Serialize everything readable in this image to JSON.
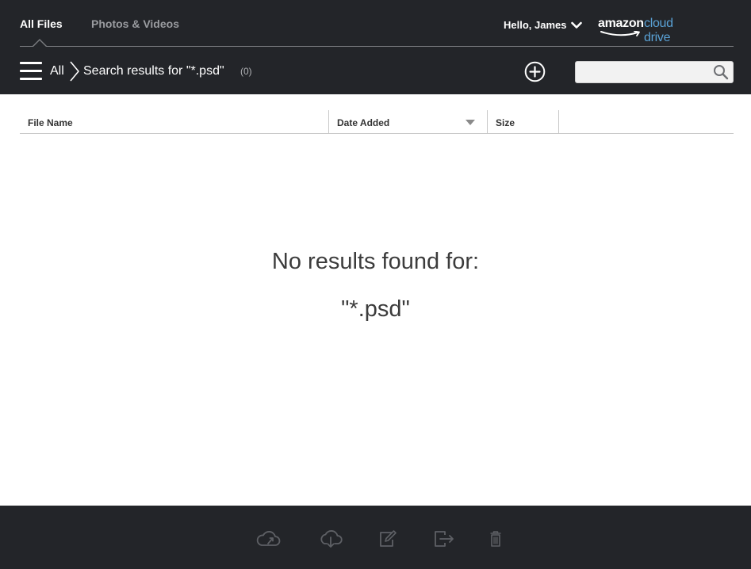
{
  "header": {
    "tabs": [
      {
        "label": "All Files",
        "active": true
      },
      {
        "label": "Photos & Videos",
        "active": false
      }
    ],
    "greeting": "Hello, James",
    "logo": {
      "amazon": "amazon",
      "cloud_drive": "cloud drive"
    },
    "breadcrumb": {
      "root": "All",
      "current": "Search results for \"*.psd\"",
      "count": "(0)"
    },
    "search": {
      "value": "",
      "placeholder": ""
    }
  },
  "table": {
    "columns": [
      "File Name",
      "Date Added",
      "Size"
    ],
    "rows": []
  },
  "empty_state": {
    "title": "No results found for:",
    "query": "\"*.psd\""
  },
  "footer": {
    "tools": [
      "upload-icon",
      "download-icon",
      "rename-icon",
      "move-icon",
      "trash-icon"
    ]
  },
  "colors": {
    "chrome": "#232529",
    "accent_blue": "#5aa2d6",
    "icon_disabled": "#5e6065"
  }
}
